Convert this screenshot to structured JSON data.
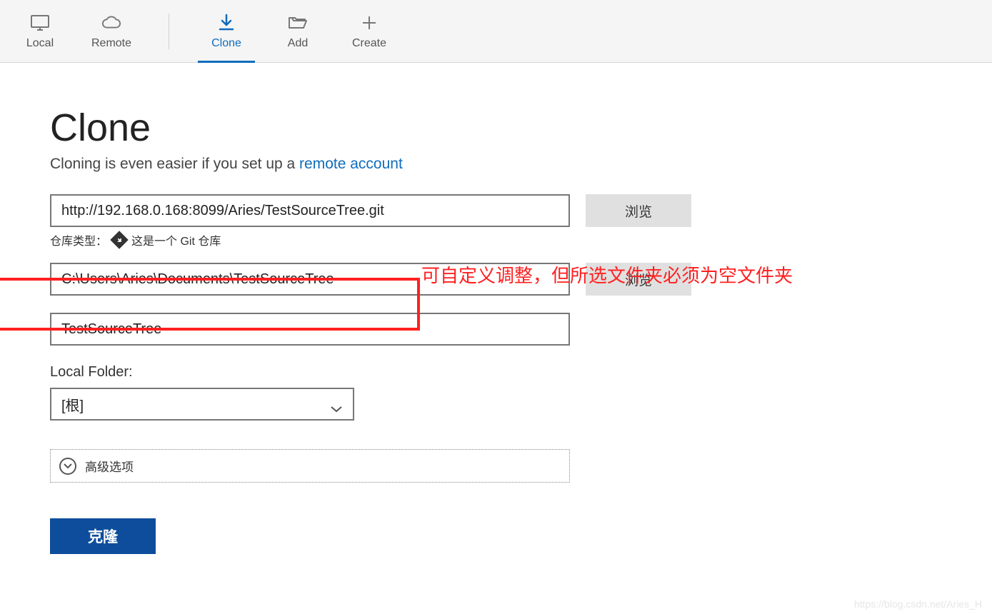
{
  "toolbar": {
    "items": [
      {
        "label": "Local"
      },
      {
        "label": "Remote"
      },
      {
        "label": "Clone"
      },
      {
        "label": "Add"
      },
      {
        "label": "Create"
      }
    ]
  },
  "page": {
    "title": "Clone",
    "subtitle_prefix": "Cloning is even easier if you set up a ",
    "subtitle_link": "remote account"
  },
  "form": {
    "source_url": "http://192.168.0.168:8099/Aries/TestSourceTree.git",
    "browse_label": "浏览",
    "repo_type_label": "仓库类型：",
    "repo_type_value": "这是一个 Git 仓库",
    "dest_path": "C:\\Users\\Aries\\Documents\\TestSourceTree",
    "name": "TestSourceTree",
    "local_folder_label": "Local Folder:",
    "local_folder_value": "[根]",
    "advanced_label": "高级选项",
    "submit_label": "克隆"
  },
  "annotation": {
    "text": "可自定义调整，但所选文件夹必须为空文件夹"
  },
  "watermark": "https://blog.csdn.net/Aries_H"
}
